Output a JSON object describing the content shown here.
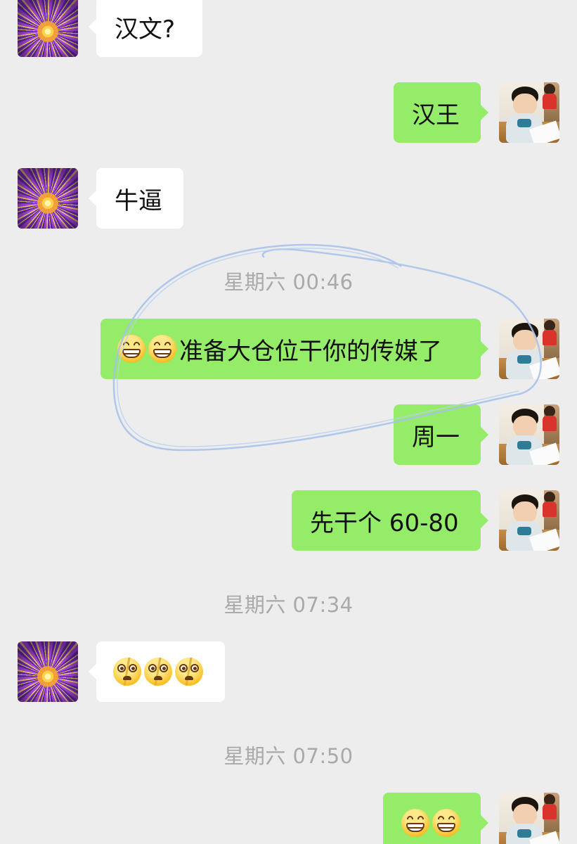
{
  "messages": [
    {
      "side": "left",
      "text": "汉文?"
    },
    {
      "side": "right",
      "text": "汉王"
    },
    {
      "side": "left",
      "text": "牛逼"
    },
    {
      "timestamp": "星期六 00:46"
    },
    {
      "side": "right",
      "emoji": [
        "grinning-face-icon",
        "grinning-face-icon"
      ],
      "text": "准备大仓位干你的传媒了"
    },
    {
      "side": "right",
      "text": "周一"
    },
    {
      "side": "right",
      "text": "先干个 60-80"
    },
    {
      "timestamp": "星期六 07:34"
    },
    {
      "side": "left",
      "emoji": [
        "dizzy-cracked-face-icon",
        "dizzy-cracked-face-icon",
        "dizzy-cracked-face-icon"
      ]
    },
    {
      "timestamp": "星期六 07:50"
    },
    {
      "side": "right",
      "emoji": [
        "grinning-face-icon",
        "grinning-face-icon"
      ]
    }
  ],
  "colors": {
    "background": "#ededed",
    "bubble_self": "#95ec69",
    "bubble_other": "#ffffff",
    "timestamp": "#a9a9a9",
    "scribble": "#a9c2ea"
  },
  "avatars": {
    "other": "fireworks-avatar",
    "self": "child-photo-avatar"
  }
}
